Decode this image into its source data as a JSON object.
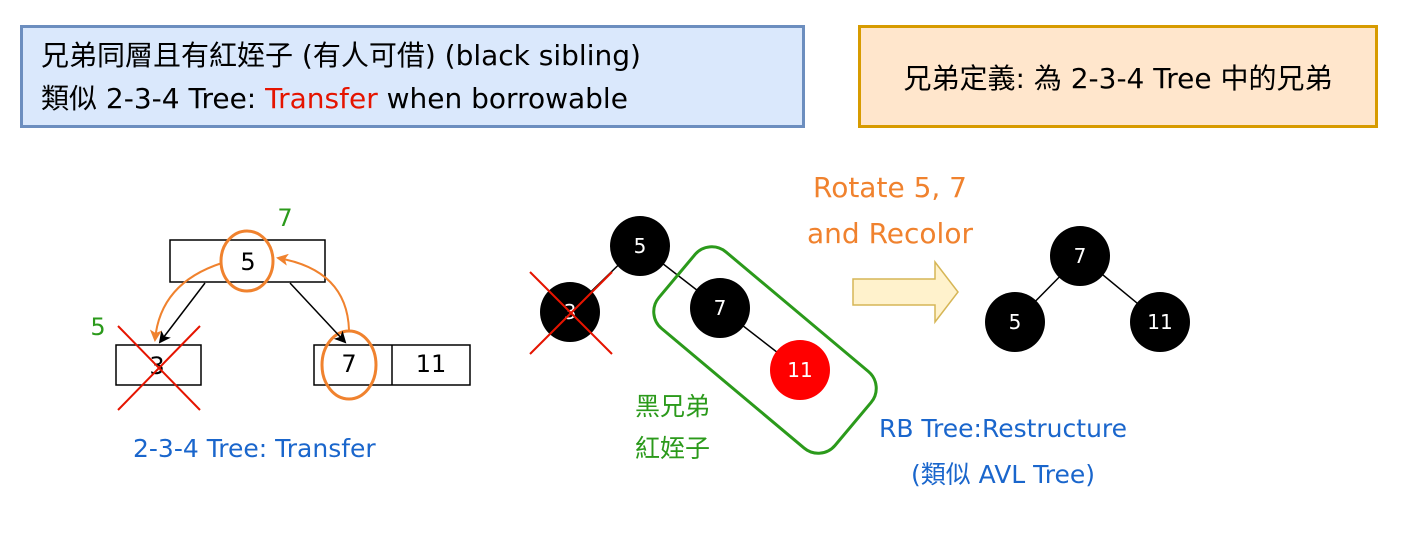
{
  "note_box": {
    "line1": "兄弟同層且有紅姪子 (有人可借) (black sibling)",
    "line2_prefix": "類似 2-3-4 Tree: ",
    "line2_highlight": "Transfer",
    "line2_suffix": " when borrowable"
  },
  "definition_box": {
    "text": "兄弟定義: 為 2-3-4 Tree 中的兄弟"
  },
  "tree234": {
    "parent_key": "5",
    "new_parent_label": "7",
    "left_child_key": "3",
    "new_left_label": "5",
    "right_child_keys": [
      "7",
      "11"
    ],
    "caption": "2-3-4 Tree: Transfer"
  },
  "rb_before": {
    "nodes": [
      "5",
      "3",
      "7",
      "11"
    ],
    "sibling_caption_line1": "黑兄弟",
    "sibling_caption_line2": "紅姪子"
  },
  "operation": {
    "line1": "Rotate 5, 7",
    "line2": "and Recolor"
  },
  "rb_after": {
    "nodes": [
      "7",
      "5",
      "11"
    ],
    "caption_line1": "RB Tree:Restructure",
    "caption_line2": "(類似 AVL Tree)"
  },
  "colors": {
    "black_node": "#000000",
    "red_node": "#ff0000",
    "cross": "#e51400",
    "orange": "#f0822e",
    "green": "#2b9a1b",
    "blue": "#1a66cc"
  }
}
